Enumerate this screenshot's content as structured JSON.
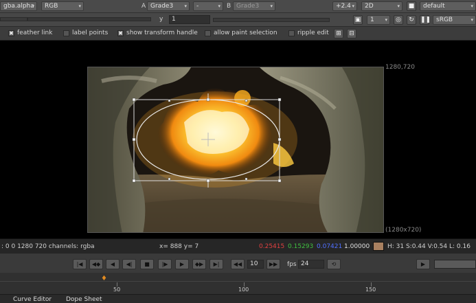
{
  "toolbar1": {
    "channel_layer": "gba.alpha",
    "channel_mode": "RGB",
    "a_label": "A",
    "a_input": "Grade3",
    "compare_mode": "-",
    "b_label": "B",
    "b_input": "Grade3",
    "gain_value": "+2.4",
    "view_mode": "2D",
    "lut_profile": "default"
  },
  "toolbar2": {
    "gain_field": "",
    "gamma_label": "y",
    "gamma_value": "1",
    "frame_number": "1",
    "colorspace": "sRGB"
  },
  "roto_options": {
    "feather_link": "feather link",
    "label_points": "label points",
    "show_transform_handle": "show transform handle",
    "allow_paint_selection": "allow paint selection",
    "ripple_edit": "ripple edit"
  },
  "viewer": {
    "format_top_right": "1280,720",
    "format_bottom_right": "(1280x720)"
  },
  "info_bar": {
    "bbox_channels": ": 0 0 1280 720 channels: rgba",
    "coords": "x= 888 y=   7",
    "red": "0.25415",
    "green": "0.15293",
    "blue": "0.07421",
    "alpha": "1.00000",
    "hsvl": "H: 31 S:0.44 V:0.54  L: 0.16",
    "swatch_color": "#a88060"
  },
  "transport": {
    "increment": "10",
    "fps_label": "fps",
    "fps_value": "24"
  },
  "timeline": {
    "ticks": [
      "50",
      "100",
      "150"
    ],
    "current_frame_marker": "playhead"
  },
  "tabs": {
    "curve_editor": "Curve Editor",
    "dope_sheet": "Dope Sheet"
  },
  "colors": {
    "red_text": "#e04040",
    "green_text": "#40c040",
    "blue_text": "#5070ff",
    "playhead": "#e08a20"
  }
}
